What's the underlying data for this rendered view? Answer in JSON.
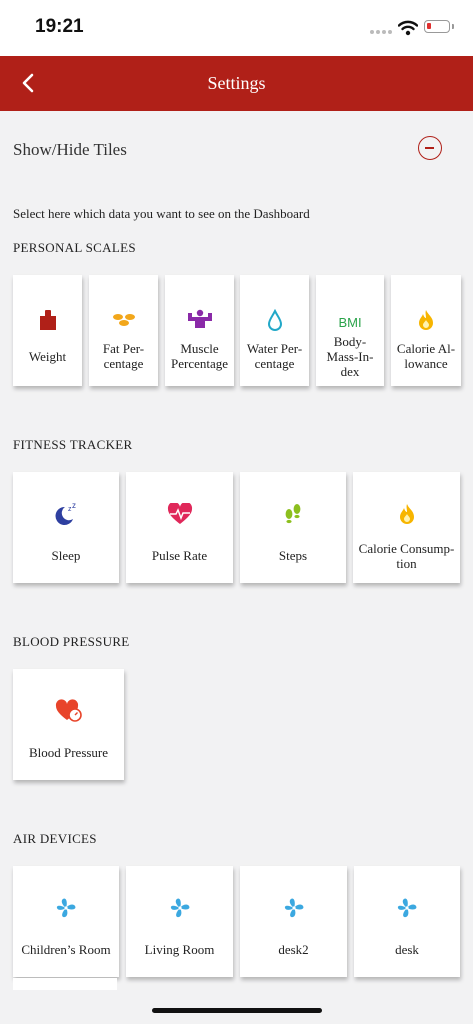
{
  "status": {
    "time": "19:21"
  },
  "nav": {
    "title": "Settings"
  },
  "tiles_header": {
    "title": "Show/Hide Tiles"
  },
  "description": "Select here which data you want to see on the Dashboard",
  "groups": [
    {
      "title": "PERSONAL SCALES",
      "tiles": [
        {
          "label": "Weight",
          "icon": "weight-icon"
        },
        {
          "label": "Fat Per-\ncentage",
          "icon": "fat-icon"
        },
        {
          "label": "Muscle\nPercentage",
          "icon": "muscle-icon"
        },
        {
          "label": "Water Per-\ncentage",
          "icon": "water-drop-icon"
        },
        {
          "label": "Body-\nMass-In-\ndex",
          "icon": "bmi-icon",
          "icon_text": "BMI"
        },
        {
          "label": "Calorie Al-\nlowance",
          "icon": "flame-icon"
        }
      ]
    },
    {
      "title": "FITNESS TRACKER",
      "tiles": [
        {
          "label": "Sleep",
          "icon": "moon-icon"
        },
        {
          "label": "Pulse Rate",
          "icon": "heart-pulse-icon"
        },
        {
          "label": "Steps",
          "icon": "footsteps-icon"
        },
        {
          "label": "Calorie Consump-\ntion",
          "icon": "flame-icon"
        }
      ]
    },
    {
      "title": "BLOOD PRESSURE",
      "tiles": [
        {
          "label": "Blood Pressure",
          "icon": "heart-gauge-icon"
        }
      ]
    },
    {
      "title": "AIR DEVICES",
      "tiles": [
        {
          "label": "Children’s Room",
          "icon": "fan-icon"
        },
        {
          "label": "Living Room",
          "icon": "fan-icon"
        },
        {
          "label": "desk2",
          "icon": "fan-icon"
        },
        {
          "label": "desk",
          "icon": "fan-icon"
        }
      ]
    }
  ],
  "colors": {
    "accent": "#b02018",
    "background": "#f2f2f3",
    "tile": "#ffffff"
  }
}
